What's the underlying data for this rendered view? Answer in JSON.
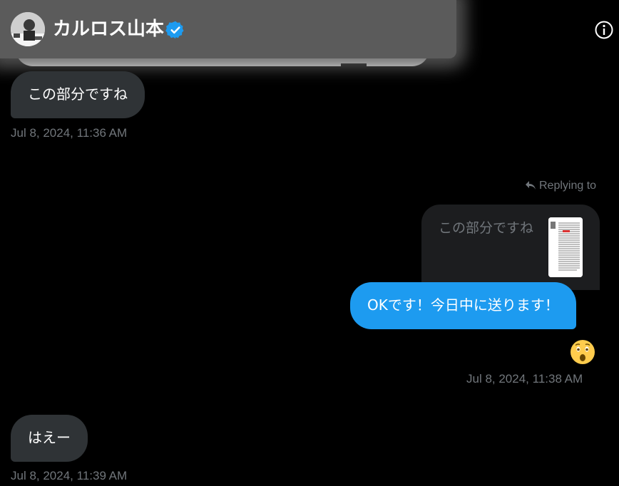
{
  "header": {
    "contact_name": "カルロス山本",
    "verified": true,
    "info_icon": "info-icon"
  },
  "messages": [
    {
      "direction": "incoming",
      "text": "この部分ですね",
      "timestamp": "Jul 8, 2024, 11:36 AM"
    },
    {
      "direction": "outgoing",
      "replying_label": "Replying to",
      "quoted_text": "この部分ですね",
      "text": "OKです！今日中に送ります！",
      "reaction": "astonished-face",
      "timestamp": "Jul 8, 2024, 11:38 AM"
    },
    {
      "direction": "incoming",
      "text": "はえー",
      "timestamp": "Jul 8, 2024, 11:39 AM"
    }
  ],
  "colors": {
    "background": "#000000",
    "incoming_bubble": "#2f3336",
    "outgoing_bubble": "#1d9bf0",
    "timestamp": "#71767b",
    "verified_badge": "#1d9bf0"
  }
}
